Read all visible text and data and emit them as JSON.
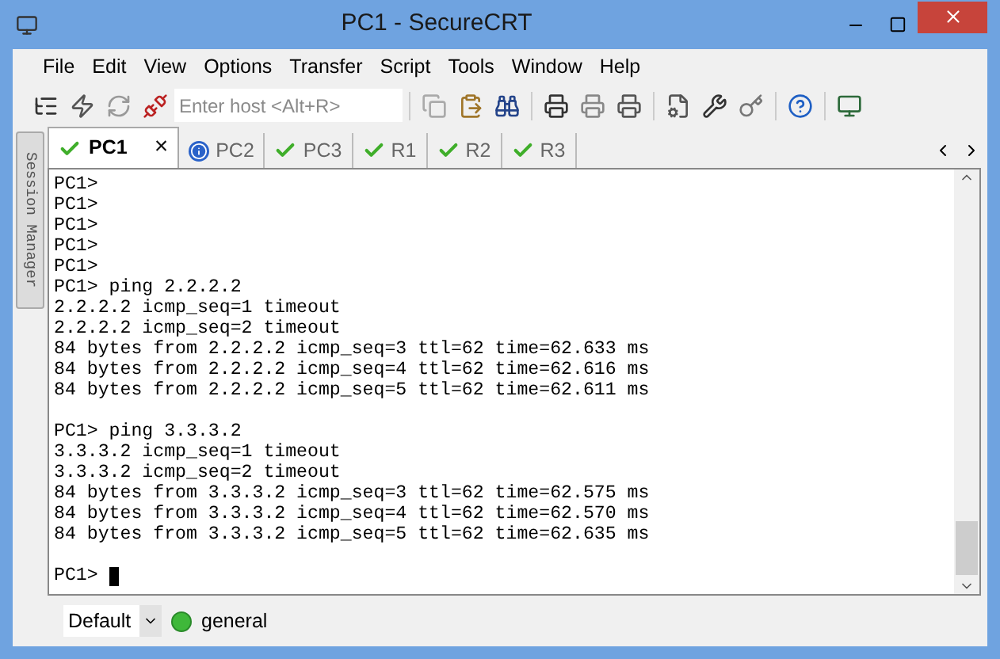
{
  "window": {
    "title": "PC1 - SecureCRT"
  },
  "menu": [
    "File",
    "Edit",
    "View",
    "Options",
    "Transfer",
    "Script",
    "Tools",
    "Window",
    "Help"
  ],
  "toolbar": {
    "host_field": {
      "placeholder": "Enter host <Alt+R>"
    }
  },
  "side_panel": {
    "label": "Session Manager"
  },
  "tabs": [
    {
      "label": "PC1",
      "kind": "connected",
      "selected": true,
      "close": "×"
    },
    {
      "label": "PC2",
      "kind": "info",
      "selected": false
    },
    {
      "label": "PC3",
      "kind": "connected",
      "selected": false
    },
    {
      "label": "R1",
      "kind": "connected",
      "selected": false
    },
    {
      "label": "R2",
      "kind": "connected",
      "selected": false
    },
    {
      "label": "R3",
      "kind": "connected",
      "selected": false
    }
  ],
  "terminal": {
    "blocks": [
      [
        "PC1>",
        "PC1>",
        "PC1>",
        "PC1>",
        "PC1>",
        "PC1> ping 2.2.2.2",
        "2.2.2.2 icmp_seq=1 timeout",
        "2.2.2.2 icmp_seq=2 timeout",
        "84 bytes from 2.2.2.2 icmp_seq=3 ttl=62 time=62.633 ms",
        "84 bytes from 2.2.2.2 icmp_seq=4 ttl=62 time=62.616 ms",
        "84 bytes from 2.2.2.2 icmp_seq=5 ttl=62 time=62.611 ms"
      ],
      [
        "PC1> ping 3.3.3.2",
        "3.3.3.2 icmp_seq=1 timeout",
        "3.3.3.2 icmp_seq=2 timeout",
        "84 bytes from 3.3.3.2 icmp_seq=3 ttl=62 time=62.575 ms",
        "84 bytes from 3.3.3.2 icmp_seq=4 ttl=62 time=62.570 ms",
        "84 bytes from 3.3.3.2 icmp_seq=5 ttl=62 time=62.635 ms"
      ],
      [
        "PC1>"
      ]
    ]
  },
  "status_bar": {
    "profile": "Default",
    "session": "general"
  }
}
